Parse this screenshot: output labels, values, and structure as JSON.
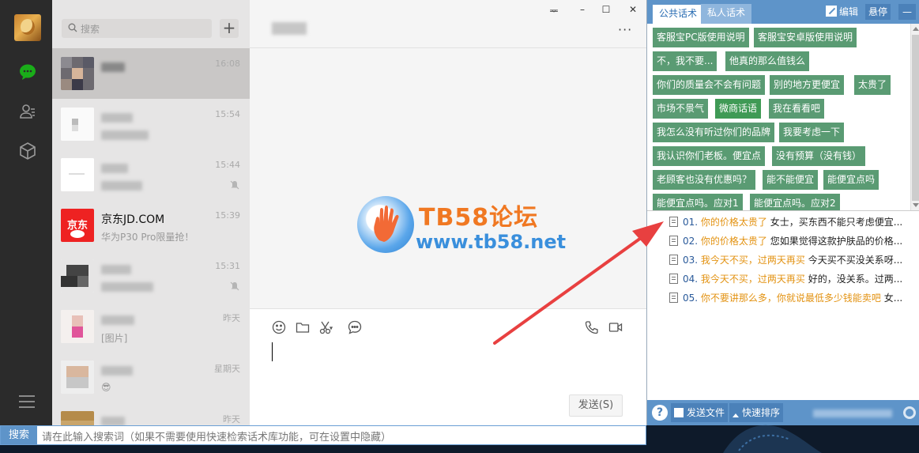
{
  "wechat": {
    "search_placeholder": "搜索",
    "add_symbol": "+",
    "chats": [
      {
        "name": "",
        "preview": "",
        "time": "16:08",
        "active": true
      },
      {
        "name": "",
        "preview": "",
        "time": "15:54",
        "muted": false
      },
      {
        "name": "",
        "preview": "",
        "time": "15:44",
        "muted": true
      },
      {
        "name": "京东JD.COM",
        "preview": "华为P30 Pro限量抢！",
        "time": "15:39",
        "muted": false
      },
      {
        "name": "",
        "preview": "",
        "time": "15:31",
        "muted": true
      },
      {
        "name": "",
        "preview": "[图片]",
        "time": "昨天",
        "muted": false
      },
      {
        "name": "",
        "preview": "😎",
        "time": "星期天",
        "muted": false
      },
      {
        "name": "",
        "preview": "",
        "time": "昨天",
        "muted": false
      }
    ],
    "window_controls": {
      "pin": "ᆓ",
      "minimize": "–",
      "maximize": "☐",
      "close": "✕"
    },
    "more": "···",
    "send_label": "发送(S)",
    "jd_logo_text": "京东"
  },
  "watermark": {
    "title": "TB58论坛",
    "url": "www.tb58.net"
  },
  "panel": {
    "tab_public": "公共话术",
    "tab_private": "私人话术",
    "edit_label": "编辑",
    "pin_label": "悬停",
    "min_label": "—",
    "tags": [
      "客服宝PC版使用说明",
      "客服宝安卓版使用说明",
      "不，我不要...",
      "他真的那么值钱么",
      "你们的质量会不会有问题",
      "别的地方更便宜",
      "太贵了",
      "市场不景气",
      "微商话语",
      "我在看看吧",
      "我怎么没有听过你们的品牌",
      "我要考虑一下",
      "我认识你们老板。便宜点",
      "没有预算（没有钱）",
      "老顾客也没有优惠吗？",
      "能不能便宜",
      "能便宜点吗",
      "能便宜点吗。应对1",
      "能便宜点吗。应对2"
    ],
    "selected_tag": "微商话语",
    "scripts": [
      {
        "num": "01.",
        "q": "你的价格太贵了",
        "a": "女士，买东西不能只考虑便宜..."
      },
      {
        "num": "02.",
        "q": "你的价格太贵了",
        "a": "您如果觉得这款护肤品的价格..."
      },
      {
        "num": "03.",
        "q": "我今天不买，过两天再买",
        "a": "今天买不买没关系呀..."
      },
      {
        "num": "04.",
        "q": "我今天不买，过两天再买",
        "a": "好的，没关系。过两..."
      },
      {
        "num": "05.",
        "q": "你不要讲那么多，你就说最低多少钱能卖吧",
        "a": "女..."
      }
    ],
    "footer": {
      "help": "?",
      "send_file": "发送文件",
      "quick_sort": "快速排序"
    }
  },
  "bottom_search": {
    "label": "搜索",
    "placeholder": "请在此输入搜索词（如果不需要使用快速检索话术库功能，可在设置中隐藏）"
  },
  "colors": {
    "panel_blue": "#5e94c9",
    "tag_green": "#5a9b73",
    "question_orange": "#e39313",
    "arrow_red": "#e84040",
    "wechat_green": "#1aad19"
  }
}
